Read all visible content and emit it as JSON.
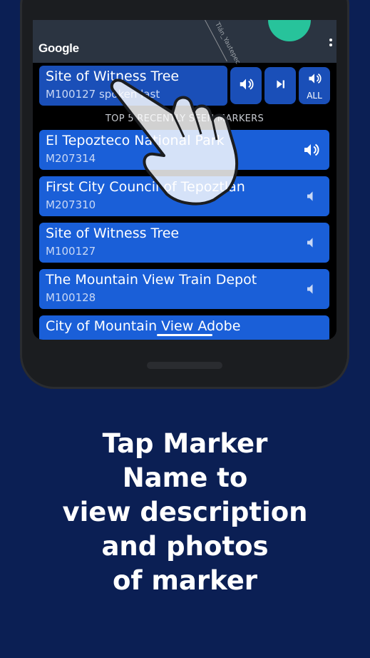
{
  "map": {
    "attribution": "Google",
    "road_label": "Tlán_Yautepec"
  },
  "current_marker": {
    "title": "Site of Witness Tree",
    "subtitle": "M100127 spoken last"
  },
  "controls": {
    "play_icon": "speaker-icon",
    "skip_icon": "skip-next-icon",
    "all_label": "ALL"
  },
  "section_header": "TOP 5 RECENTLY SEEN MARKERS",
  "markers": [
    {
      "title": "El Tepozteco National Park",
      "code": "M207314",
      "active": true
    },
    {
      "title": "First City Council of Tepoztlán",
      "code": "M207310",
      "active": false
    },
    {
      "title": "Site of Witness Tree",
      "code": "M100127",
      "active": false
    },
    {
      "title": "The Mountain View Train Depot",
      "code": "M100128",
      "active": false
    },
    {
      "title": "City of Mountain View Adobe",
      "code": "",
      "active": false
    }
  ],
  "caption": [
    "Tap Marker",
    "Name to",
    "view description",
    "and photos",
    "of marker"
  ],
  "colors": {
    "background": "#0b1f54",
    "row": "#1a5fd8",
    "control": "#1a4fb8",
    "fab": "#27c39b"
  }
}
